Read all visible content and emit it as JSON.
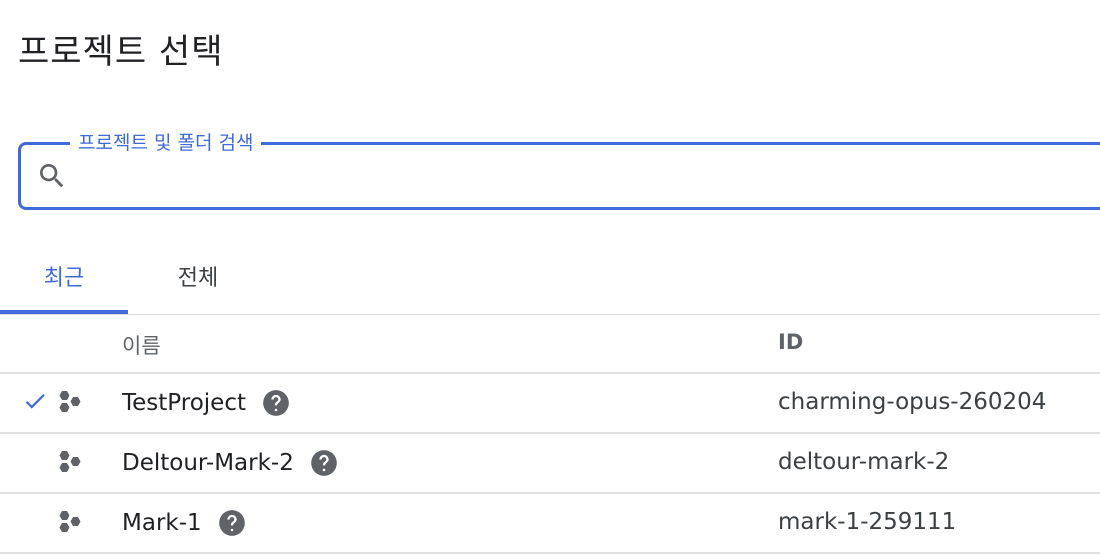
{
  "title": "프로젝트 선택",
  "search": {
    "label": "프로젝트 및 폴더 검색",
    "value": "",
    "icon": "search-icon"
  },
  "tabs": [
    {
      "label": "최근",
      "active": true
    },
    {
      "label": "전체",
      "active": false
    }
  ],
  "table": {
    "headers": {
      "name": "이름",
      "id": "ID"
    },
    "rows": [
      {
        "name": "TestProject",
        "id": "charming-opus-260204",
        "selected": true
      },
      {
        "name": "Deltour-Mark-2",
        "id": "deltour-mark-2",
        "selected": false
      },
      {
        "name": "Mark-1",
        "id": "mark-1-259111",
        "selected": false
      }
    ]
  },
  "colors": {
    "accent": "#3f6ad8",
    "text": "#202124",
    "muted": "#5f6368",
    "divider": "#e0e0e0",
    "icon": "#5f6368"
  }
}
